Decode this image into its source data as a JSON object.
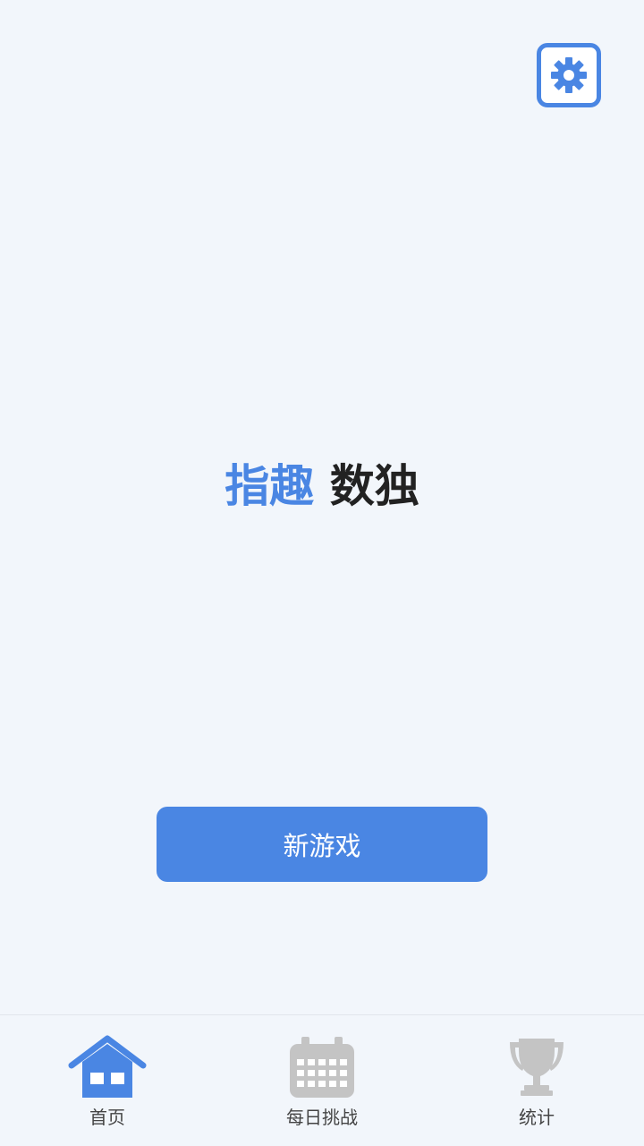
{
  "header": {
    "settings_icon": "gear-icon"
  },
  "title": {
    "part1": "指趣",
    "part2": "数独"
  },
  "main": {
    "new_game_label": "新游戏"
  },
  "bottom_nav": {
    "items": [
      {
        "label": "首页",
        "icon": "home-icon",
        "active": true
      },
      {
        "label": "每日挑战",
        "icon": "calendar-icon",
        "active": false
      },
      {
        "label": "统计",
        "icon": "trophy-icon",
        "active": false
      }
    ]
  },
  "colors": {
    "accent": "#4a86e3",
    "background": "#f2f6fb",
    "inactive_icon": "#c4c4c4",
    "title_dark": "#222222"
  }
}
